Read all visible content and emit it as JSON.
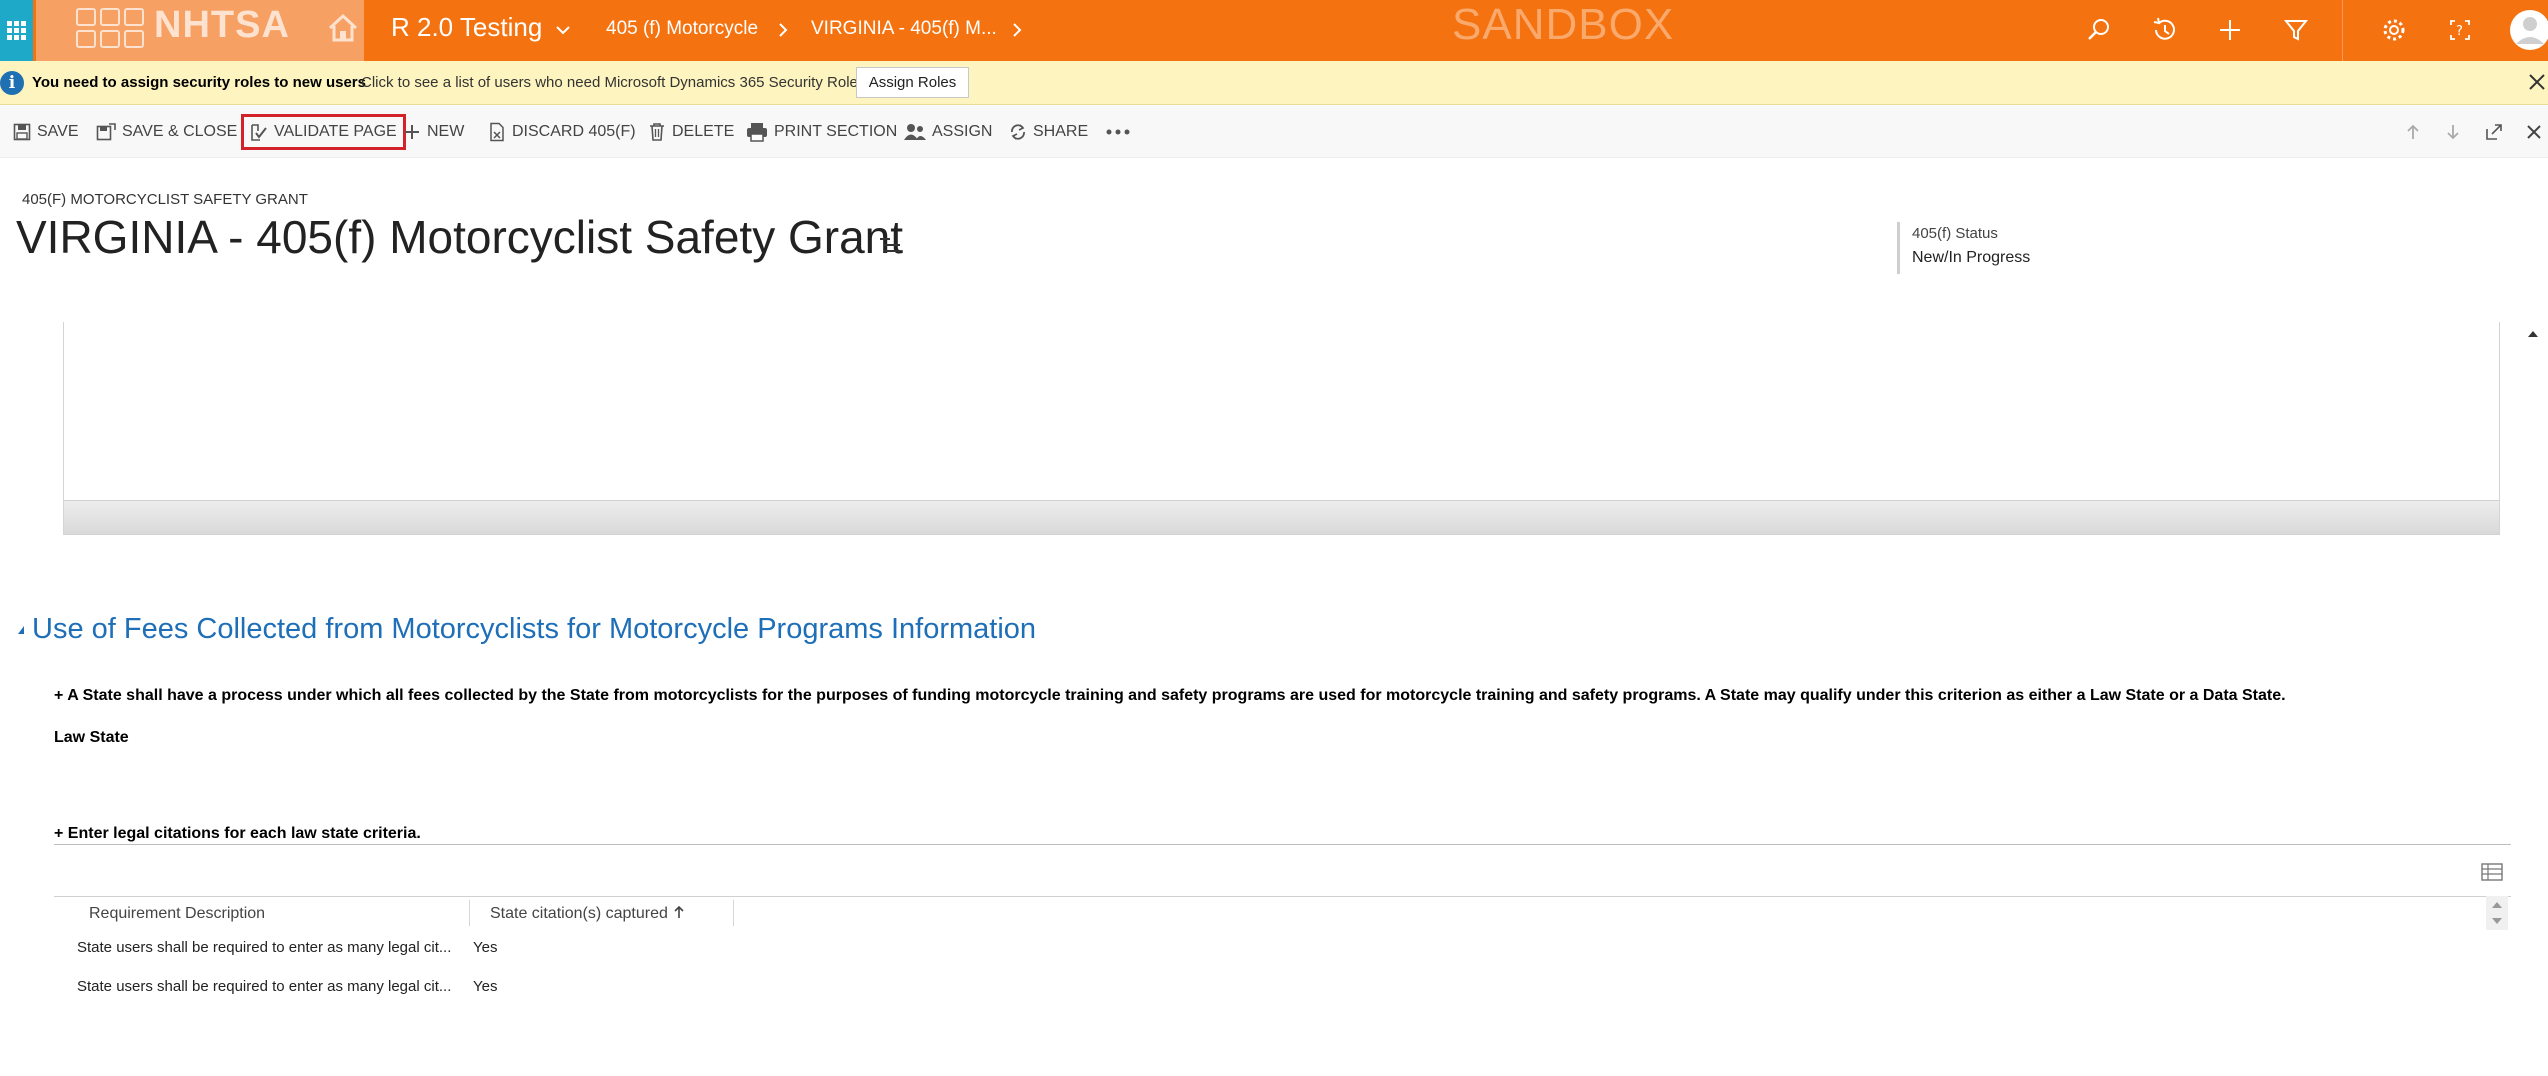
{
  "topbar": {
    "logo_text": "NHTSA",
    "app_name": "R 2.0 Testing",
    "breadcrumb": [
      "405 (f) Motorcycle",
      "VIRGINIA - 405(f) M..."
    ],
    "environment_label": "SANDBOX",
    "icons": [
      "apps-grid-icon",
      "home-icon",
      "chevron-down-icon",
      "search-icon",
      "recent-icon",
      "plus-icon",
      "filter-icon",
      "settings-icon",
      "help-icon",
      "user-avatar-icon"
    ],
    "colors": {
      "bar": "#f4720f",
      "waffle": "#1fa9c9",
      "logo_bg": "#f7a064"
    }
  },
  "notification": {
    "bold_text": "You need to assign security roles to new users",
    "message": "Click to see a list of users who need Microsoft Dynamics 365 Security Roles.",
    "button_label": "Assign Roles",
    "background": "#fdf4bf"
  },
  "commands": {
    "save": "SAVE",
    "save_close": "SAVE & CLOSE",
    "validate": "VALIDATE PAGE",
    "new": "NEW",
    "discard": "DISCARD 405(F)",
    "delete": "DELETE",
    "print": "PRINT SECTION",
    "assign": "ASSIGN",
    "share": "SHARE",
    "highlight_color": "#d2232a"
  },
  "record": {
    "entity_label": "405(F) MOTORCYCLIST SAFETY GRANT",
    "title": "VIRGINIA - 405(f) Motorcyclist Safety Grant",
    "status_label": "405(f) Status",
    "status_value": "New/In Progress"
  },
  "section": {
    "title": "Use of Fees Collected from Motorcyclists for Motorcycle Programs Information",
    "title_color": "#1e6fb8",
    "criteria_text": "+ A State shall have a process under which all fees collected by the State from motorcyclists for the purposes of funding motorcycle training and safety programs are used for motorcycle training and safety programs. A State may qualify under this criterion as either a Law State or a Data State.",
    "law_state": "Law State",
    "legal_heading": "+ Enter legal citations for each law state criteria."
  },
  "grid": {
    "columns": [
      "Requirement Description",
      "State citation(s) captured"
    ],
    "rows": [
      {
        "description": "State users shall be required to enter as many legal cit...",
        "captured": "Yes"
      },
      {
        "description": "State users shall be required to enter as many legal cit...",
        "captured": "Yes"
      }
    ]
  }
}
